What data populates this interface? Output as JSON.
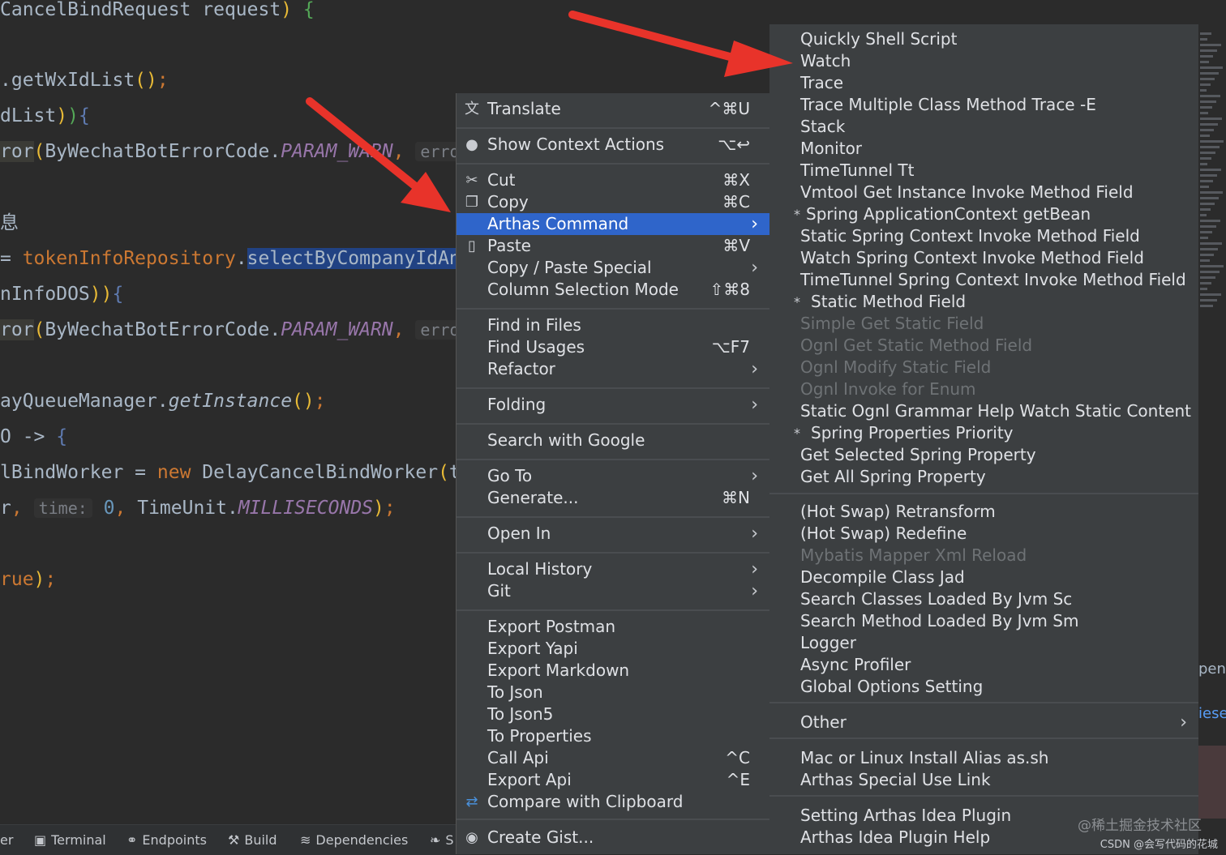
{
  "editor": {
    "lines": [
      {
        "parts": [
          [
            "",
            "CancelBindRequest request"
          ],
          [
            "c-br",
            ")"
          ],
          [
            "",
            " "
          ],
          [
            "c-br2",
            "{"
          ]
        ]
      },
      {
        "parts": [
          [
            "",
            ".getWxIdList"
          ],
          [
            "c-br",
            "()"
          ],
          [
            "c-pu",
            ";"
          ]
        ]
      },
      {
        "parts": [
          [
            "",
            "dList"
          ],
          [
            "c-br",
            ")"
          ],
          [
            "c-br2",
            ")"
          ],
          [
            "c-br3",
            "{"
          ]
        ]
      },
      {
        "parts": [
          [
            "c-op",
            "ror"
          ],
          [
            "c-br",
            "("
          ],
          [
            "",
            "ByWechatBotErrorCode."
          ],
          [
            "c-it",
            "PARAM_WARN"
          ],
          [
            "c-pu",
            ", "
          ],
          [
            "c-hint",
            "errorM"
          ]
        ]
      },
      {
        "parts": [
          [
            "",
            "息"
          ]
        ]
      },
      {
        "parts": [
          [
            "",
            "= "
          ],
          [
            "c-kw",
            "tokenInfoRepository"
          ],
          [
            "",
            "."
          ],
          [
            "c-hl",
            "selectByCompanyIdAnd"
          ]
        ]
      },
      {
        "parts": [
          [
            "",
            "nInfoDOS"
          ],
          [
            "c-br",
            "))"
          ],
          [
            "c-br3",
            "{"
          ]
        ]
      },
      {
        "parts": [
          [
            "c-op",
            "ror"
          ],
          [
            "c-br",
            "("
          ],
          [
            "",
            "ByWechatBotErrorCode."
          ],
          [
            "c-it",
            "PARAM_WARN"
          ],
          [
            "c-pu",
            ", "
          ],
          [
            "c-hint",
            "errorM"
          ]
        ]
      },
      {
        "parts": [
          [
            "",
            "ayQueueManager."
          ],
          [
            "c-it2",
            "getInstance"
          ],
          [
            "c-br",
            "()"
          ],
          [
            "c-pu",
            ";"
          ]
        ]
      },
      {
        "parts": [
          [
            "",
            "O -> "
          ],
          [
            "c-br3",
            "{"
          ]
        ]
      },
      {
        "parts": [
          [
            "",
            "lBindWorker = "
          ],
          [
            "c-kw",
            "new"
          ],
          [
            "",
            " DelayCancelBindWorker"
          ],
          [
            "c-br",
            "("
          ],
          [
            "",
            "to"
          ]
        ]
      },
      {
        "parts": [
          [
            "",
            "r"
          ],
          [
            "c-pu",
            ","
          ],
          [
            "",
            " "
          ],
          [
            "c-hint",
            "time:"
          ],
          [
            "",
            " "
          ],
          [
            "c-num",
            "0"
          ],
          [
            "c-pu",
            ","
          ],
          [
            "",
            " TimeUnit."
          ],
          [
            "c-it",
            "MILLISECONDS"
          ],
          [
            "c-br",
            ")"
          ],
          [
            "c-pu",
            ";"
          ]
        ]
      },
      {
        "parts": [
          [
            "c-kw",
            "rue"
          ],
          [
            "c-br",
            ")"
          ],
          [
            "c-pu",
            ";"
          ]
        ]
      }
    ]
  },
  "bottom_bar": [
    {
      "label": "er",
      "icon": ""
    },
    {
      "label": "Terminal",
      "icon": "terminal-icon"
    },
    {
      "label": "Endpoints",
      "icon": "endpoints-icon"
    },
    {
      "label": "Build",
      "icon": "hammer-icon"
    },
    {
      "label": "Dependencies",
      "icon": "layers-icon"
    },
    {
      "label": "S",
      "icon": "leaf-icon"
    }
  ],
  "context_menu": {
    "items": [
      {
        "label": "Translate",
        "shortcut": "^⌘U",
        "icon": "translate-icon",
        "arrow": false
      },
      {
        "label": "Show Context Actions",
        "shortcut": "⌥↩",
        "icon": "lightbulb-icon",
        "arrow": false
      },
      {
        "label": "Cut",
        "shortcut": "⌘X",
        "icon": "scissors-icon",
        "arrow": false
      },
      {
        "label": "Copy",
        "shortcut": "⌘C",
        "icon": "copy-icon",
        "arrow": false
      },
      {
        "label": "Arthas Command",
        "shortcut": "",
        "icon": "",
        "arrow": true,
        "selected": true
      },
      {
        "label": "Paste",
        "shortcut": "⌘V",
        "icon": "clipboard-icon",
        "arrow": false
      },
      {
        "label": "Copy / Paste Special",
        "shortcut": "",
        "icon": "",
        "arrow": true
      },
      {
        "label": "Column Selection Mode",
        "shortcut": "⇧⌘8",
        "icon": "",
        "arrow": false
      },
      {
        "label": "Find in Files",
        "shortcut": "",
        "icon": "",
        "arrow": false
      },
      {
        "label": "Find Usages",
        "shortcut": "⌥F7",
        "icon": "",
        "arrow": false
      },
      {
        "label": "Refactor",
        "shortcut": "",
        "icon": "",
        "arrow": true
      },
      {
        "label": "Folding",
        "shortcut": "",
        "icon": "",
        "arrow": true
      },
      {
        "label": "Search with Google",
        "shortcut": "",
        "icon": "",
        "arrow": false
      },
      {
        "label": "Go To",
        "shortcut": "",
        "icon": "",
        "arrow": true
      },
      {
        "label": "Generate...",
        "shortcut": "⌘N",
        "icon": "",
        "arrow": false
      },
      {
        "label": "Open In",
        "shortcut": "",
        "icon": "",
        "arrow": true
      },
      {
        "label": "Local History",
        "shortcut": "",
        "icon": "",
        "arrow": true
      },
      {
        "label": "Git",
        "shortcut": "",
        "icon": "",
        "arrow": true
      },
      {
        "label": "Export Postman",
        "shortcut": "",
        "icon": "",
        "arrow": false
      },
      {
        "label": "Export Yapi",
        "shortcut": "",
        "icon": "",
        "arrow": false
      },
      {
        "label": "Export Markdown",
        "shortcut": "",
        "icon": "",
        "arrow": false
      },
      {
        "label": "To Json",
        "shortcut": "",
        "icon": "",
        "arrow": false
      },
      {
        "label": "To Json5",
        "shortcut": "",
        "icon": "",
        "arrow": false
      },
      {
        "label": "To Properties",
        "shortcut": "",
        "icon": "",
        "arrow": false
      },
      {
        "label": "Call Api",
        "shortcut": "^C",
        "icon": "",
        "arrow": false
      },
      {
        "label": "Export Api",
        "shortcut": "^E",
        "icon": "",
        "arrow": false
      },
      {
        "label": "Compare with Clipboard",
        "shortcut": "",
        "icon": "compare-icon",
        "arrow": false
      },
      {
        "label": "Create Gist...",
        "shortcut": "",
        "icon": "github-icon",
        "arrow": false
      }
    ]
  },
  "arthas_submenu": {
    "items": [
      {
        "label": "Quickly Shell Script",
        "star": false,
        "disabled": false
      },
      {
        "label": "Watch",
        "star": false,
        "disabled": false
      },
      {
        "label": "Trace",
        "star": false,
        "disabled": false
      },
      {
        "label": "Trace Multiple Class Method Trace -E",
        "star": false,
        "disabled": false
      },
      {
        "label": "Stack",
        "star": false,
        "disabled": false
      },
      {
        "label": "Monitor",
        "star": false,
        "disabled": false
      },
      {
        "label": "TimeTunnel Tt",
        "star": false,
        "disabled": false
      },
      {
        "label": "Vmtool Get Instance Invoke Method Field",
        "star": false,
        "disabled": false
      },
      {
        "label": "Spring ApplicationContext getBean",
        "star": true,
        "disabled": false
      },
      {
        "label": "Static Spring Context Invoke  Method Field",
        "star": false,
        "disabled": false
      },
      {
        "label": "Watch Spring Context Invoke Method Field",
        "star": false,
        "disabled": false
      },
      {
        "label": "TimeTunnel Spring Context Invoke Method Field",
        "star": false,
        "disabled": false
      },
      {
        "label": "Static Method Field",
        "star": true,
        "disabled": false
      },
      {
        "label": "Simple Get Static Field",
        "star": false,
        "disabled": true
      },
      {
        "label": "Ognl Get Static Method Field",
        "star": false,
        "disabled": true
      },
      {
        "label": "Ognl Modify Static Field",
        "star": false,
        "disabled": true
      },
      {
        "label": "Ognl Invoke for Enum",
        "star": false,
        "disabled": true
      },
      {
        "label": "Static Ognl Grammar Help Watch Static Content",
        "star": false,
        "disabled": false
      },
      {
        "label": "Spring Properties Priority",
        "star": true,
        "disabled": false
      },
      {
        "label": "Get Selected Spring Property",
        "star": false,
        "disabled": false
      },
      {
        "label": "Get All Spring Property",
        "star": false,
        "disabled": false
      },
      {
        "label": "(Hot Swap) Retransform",
        "star": false,
        "disabled": false
      },
      {
        "label": "(Hot Swap) Redefine",
        "star": false,
        "disabled": false
      },
      {
        "label": "Mybatis Mapper Xml Reload",
        "star": false,
        "disabled": true
      },
      {
        "label": "Decompile Class Jad",
        "star": false,
        "disabled": false
      },
      {
        "label": "Search Classes Loaded By Jvm Sc",
        "star": false,
        "disabled": false
      },
      {
        "label": "Search Method Loaded By Jvm Sm",
        "star": false,
        "disabled": false
      },
      {
        "label": "Logger",
        "star": false,
        "disabled": false
      },
      {
        "label": "Async Profiler",
        "star": false,
        "disabled": false
      },
      {
        "label": "Global Options Setting",
        "star": false,
        "disabled": false
      },
      {
        "label": "Other",
        "star": false,
        "disabled": false,
        "arrow": true
      },
      {
        "label": "Mac or Linux Install Alias as.sh",
        "star": false,
        "disabled": false
      },
      {
        "label": "Arthas Special Use Link",
        "star": false,
        "disabled": false
      },
      {
        "label": "Setting Arthas Idea Plugin",
        "star": false,
        "disabled": false
      },
      {
        "label": "Arthas Idea Plugin Help",
        "star": false,
        "disabled": false
      }
    ]
  },
  "side_text": {
    "top": "pend",
    "bottom": "iese"
  },
  "watermark": {
    "line1": "@稀土掘金技术社区",
    "line2": "CSDN @会写代码的花城"
  },
  "colors": {
    "selection": "#2f65ca",
    "menu_bg": "#3c3f41",
    "arrow": "#e8332a"
  }
}
